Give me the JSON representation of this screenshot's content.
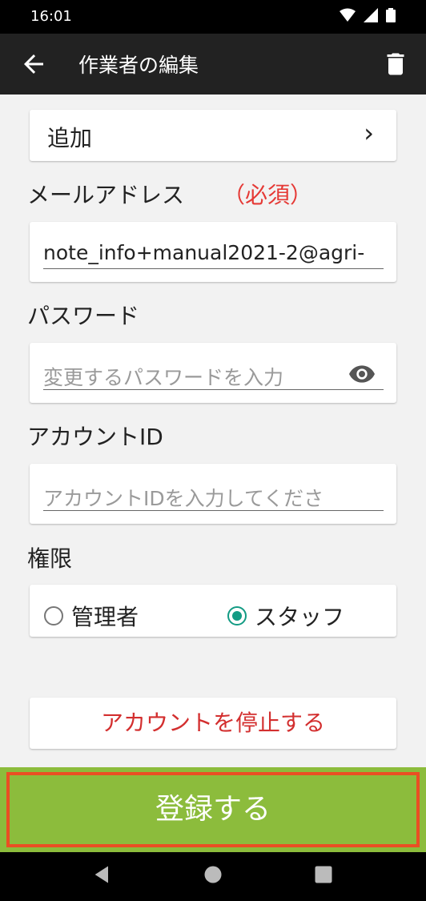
{
  "status_bar": {
    "time": "16:01"
  },
  "app_bar": {
    "title": "作業者の編集"
  },
  "add_row": {
    "label": "追加",
    "chevron": "›"
  },
  "email": {
    "label": "メールアドレス",
    "required": "（必須）",
    "value": "note_info+manual2021-2@agri-"
  },
  "password": {
    "label": "パスワード",
    "placeholder": "変更するパスワードを入力"
  },
  "account_id": {
    "label": "アカウントID",
    "placeholder": "アカウントIDを入力してくださ"
  },
  "permission": {
    "label": "権限",
    "options": [
      {
        "label": "管理者",
        "selected": false
      },
      {
        "label": "スタッフ",
        "selected": true
      }
    ]
  },
  "stop_account": {
    "label": "アカウントを停止する"
  },
  "submit": {
    "label": "登録する"
  },
  "colors": {
    "accent": "#139b84",
    "submit_bg": "#8cbc3c",
    "danger": "#d32f2f",
    "highlight_border": "#ea4f23"
  },
  "icons": {
    "back": "arrow-left-icon",
    "trash": "trash-icon",
    "eye": "eye-icon",
    "wifi": "wifi-icon",
    "signal": "signal-icon",
    "battery": "battery-icon"
  }
}
